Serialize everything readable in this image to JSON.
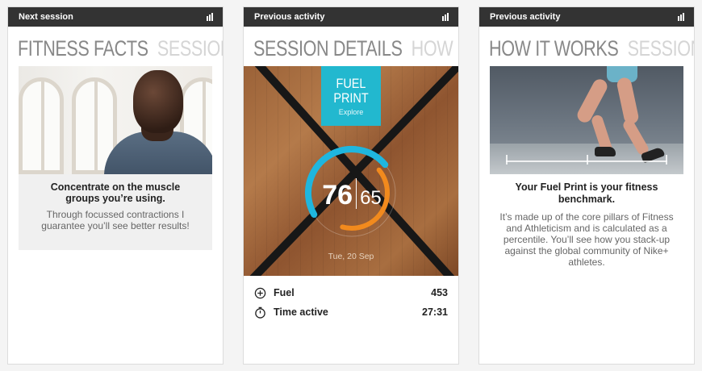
{
  "cards": [
    {
      "topbar_label": "Next session",
      "headline_active": "FITNESS FACTS",
      "headline_next": "SESSION DETAILS",
      "caption_title": "Concentrate on the muscle groups you’re using.",
      "caption_body": "Through focussed contractions I guarantee you’ll see better results!"
    },
    {
      "topbar_label": "Previous activity",
      "headline_active": "SESSION DETAILS",
      "headline_next": "HOW IT WORKS",
      "badge": {
        "line1": "FUEL",
        "line2": "PRINT",
        "line3": "Explore"
      },
      "score_major": "76",
      "score_minor": "65",
      "date": "Tue, 20 Sep",
      "stats": [
        {
          "label": "Fuel",
          "value": "453",
          "icon": "plus-circle-icon"
        },
        {
          "label": "Time active",
          "value": "27:31",
          "icon": "stopwatch-icon"
        }
      ]
    },
    {
      "topbar_label": "Previous activity",
      "headline_active": "HOW IT WORKS",
      "headline_next": "SESSION DETAILS",
      "title": "Your Fuel Print is your fitness benchmark.",
      "body": "It’s made up of the core pillars of Fitness and Athleticism and is calculated as a percentile. You’ll see how you stack-up against the global community of Nike+ athletes."
    }
  ],
  "colors": {
    "topbar": "#333333",
    "badge": "#22b8cf",
    "gauge_blue": "#1fb6de",
    "gauge_orange": "#f28a1d"
  },
  "gauge": {
    "blue_fraction": 0.76,
    "orange_fraction": 0.65
  }
}
